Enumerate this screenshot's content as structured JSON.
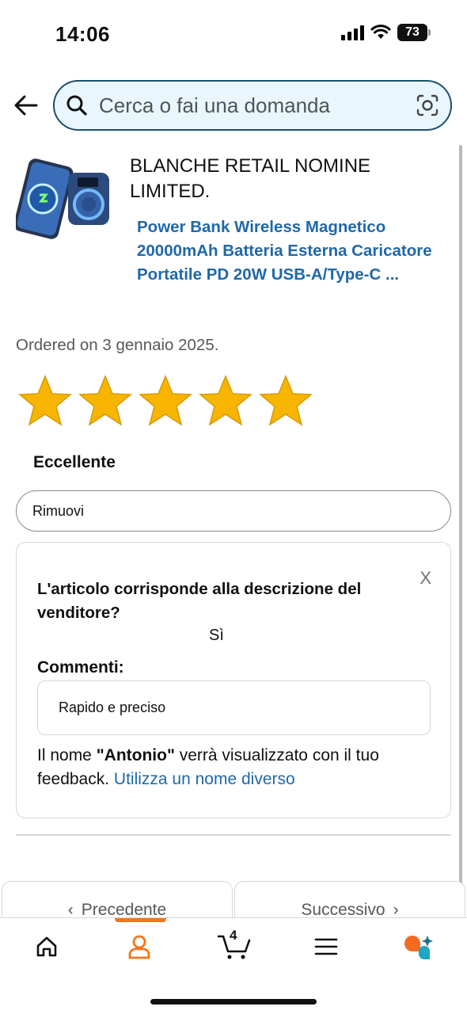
{
  "status_bar": {
    "time": "14:06",
    "battery": "73"
  },
  "search": {
    "placeholder": "Cerca o fai una domanda"
  },
  "product": {
    "seller": "BLANCHE RETAIL NOMINE LIMITED.",
    "title": "Power Bank Wireless Magnetico 20000mAh Batteria Esterna Caricatore Portatile PD 20W USB-A/Type-C ...",
    "ordered": "Ordered on 3 gennaio 2025."
  },
  "rating": {
    "stars": 5,
    "max_stars": 5,
    "label": "Eccellente"
  },
  "remove_label": "Rimuovi",
  "feedback_card": {
    "close_label": "X",
    "question": "L'articolo corrisponde alla descrizione del venditore?",
    "answer": "Sì",
    "comments_label": "Commenti:",
    "comment_text": "Rapido e preciso",
    "name_note_prefix": "Il nome ",
    "name": "\"Antonio\"",
    "name_note_suffix": " verrà visualizzato con il tuo feedback. ",
    "change_name_link": "Utilizza un nome diverso"
  },
  "pager": {
    "prev_label": "Precedente",
    "next_label": "Successivo"
  },
  "bottom_nav": {
    "cart_count": "4",
    "active_color": "#f3761a",
    "items": [
      "home-icon",
      "account-icon",
      "cart-icon",
      "menu-icon",
      "ai-assistant-icon"
    ]
  },
  "colors": {
    "link": "#1f68a9",
    "search_border": "#1c4f6b",
    "search_bg": "#eaf6fd",
    "star": "#f7b500"
  }
}
